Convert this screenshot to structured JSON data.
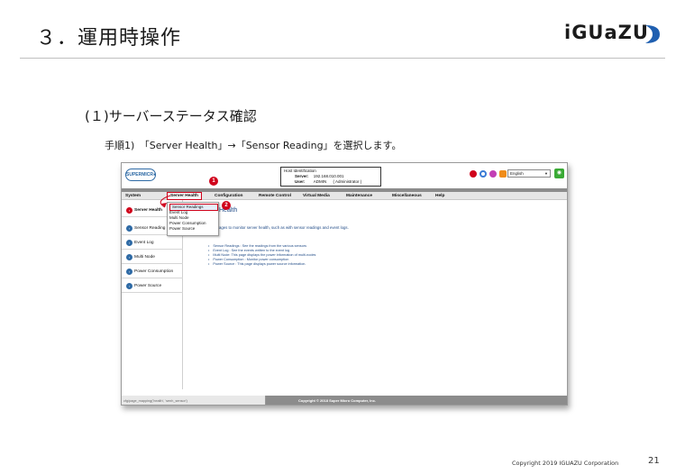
{
  "slide": {
    "title": "３．運用時操作",
    "section_heading": "(１)サーバーステータス確認",
    "step_text": "手順1)　「Server Health」→「Sensor Reading」を選択します。",
    "footer_copyright": "Copyright 2019 IGUAZU Corporation",
    "page_number": "21",
    "logo_text": "iGUaZU"
  },
  "screenshot": {
    "brand": "SUPERMICR●",
    "host": {
      "heading": "Host Identification",
      "server_label": "Server:",
      "server_value": "192.168.010.001",
      "user_label": "User:",
      "user_value": "ADMIN",
      "user_role": "( Administrator )"
    },
    "language": "English",
    "menu": [
      "System",
      "Server Health",
      "Configuration",
      "Remote Control",
      "Virtual Media",
      "Maintenance",
      "Miscellaneous",
      "Help"
    ],
    "sidebar": [
      "Server Health",
      "Sensor Reading",
      "Event Log",
      "Multi Node",
      "Power Consumption",
      "Power Source"
    ],
    "dropdown": [
      "Sensor Readings",
      "Event Log",
      "Multi Node",
      "Power Consumption",
      "Power Source"
    ],
    "content_title": "Health",
    "content_intro": "e pages to monitor server health, such as with sensor readings and event logs.",
    "content_list": [
      "Sensor Readings : See the readings from the various sensors",
      "Event Log : See the events written to the event log",
      "Multi Node: This page displays the power information of multi-nodes",
      "Power Consumption : Monitor power consumption",
      "Power Source : This page displays power source information."
    ],
    "status_url": "cfg/page_mapping('health', 'senh_sensor')",
    "status_copyright": "Copyright © 2018 Super Micro Computer, Inc.",
    "badges": [
      "1",
      "2"
    ]
  }
}
